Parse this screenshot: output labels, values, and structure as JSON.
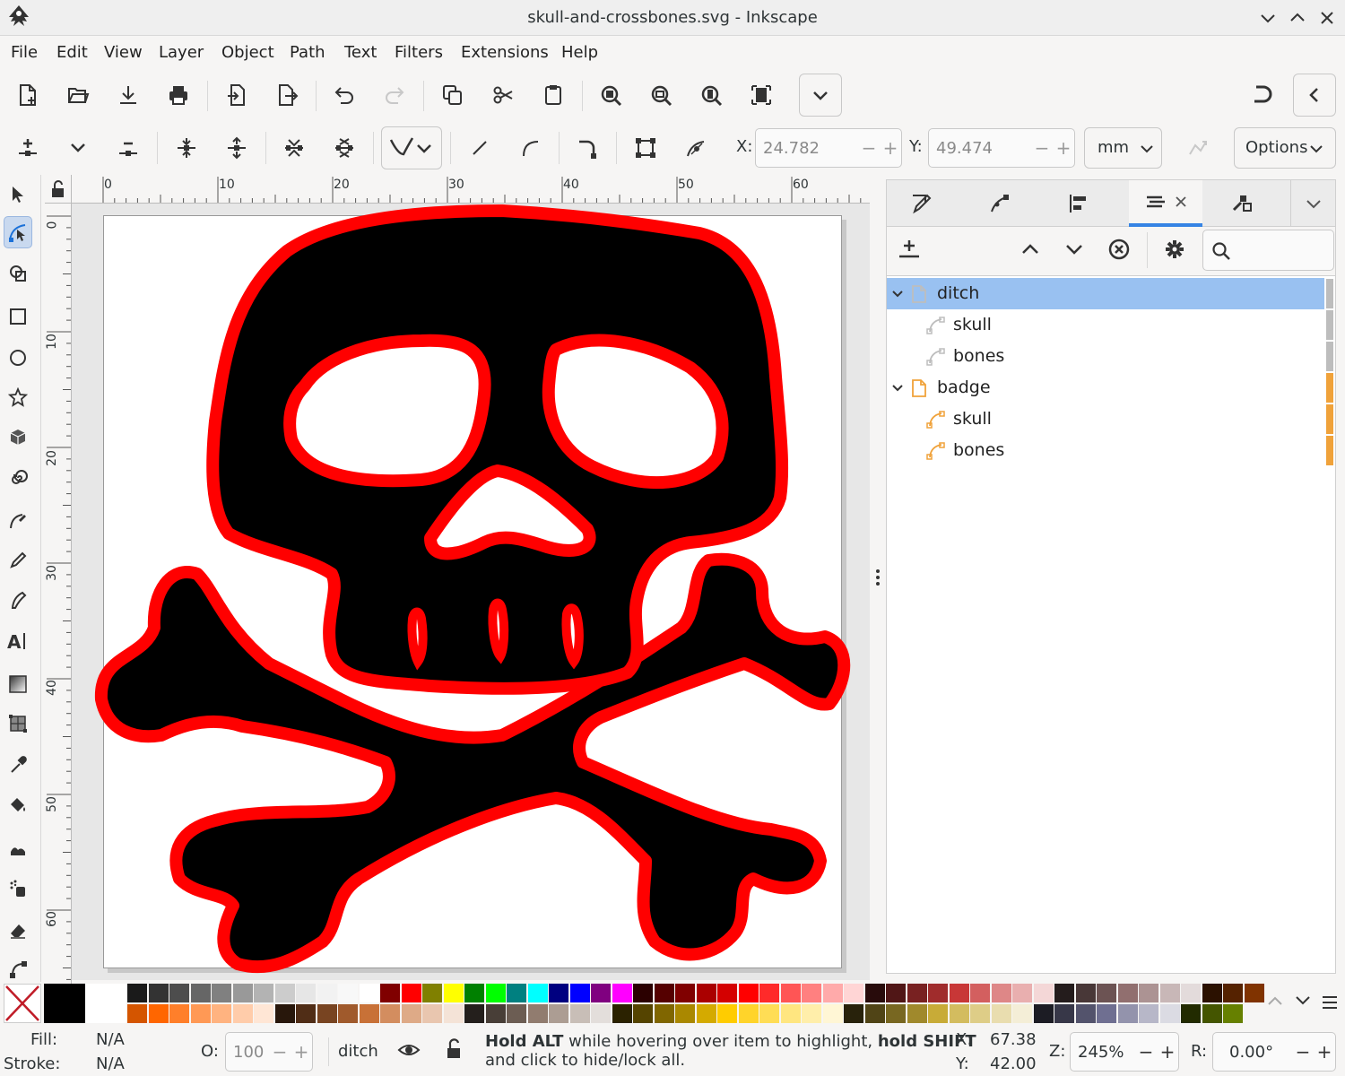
{
  "window": {
    "title": "skull-and-crossbones.svg - Inkscape"
  },
  "menu": [
    "File",
    "Edit",
    "View",
    "Layer",
    "Object",
    "Path",
    "Text",
    "Filters",
    "Extensions",
    "Help"
  ],
  "tool_controls": {
    "x_label": "X:",
    "x_value": "24.782",
    "y_label": "Y:",
    "y_value": "49.474",
    "units": "mm",
    "options_label": "Options"
  },
  "ruler_top": [
    "0",
    "10",
    "20",
    "30",
    "40",
    "50",
    "60"
  ],
  "ruler_left": [
    "0",
    "10",
    "20",
    "30",
    "40",
    "50",
    "60"
  ],
  "layers": {
    "rows": [
      {
        "label": "ditch",
        "level": 0,
        "kind": "layer",
        "selected": true,
        "tag": "#bdbdbd"
      },
      {
        "label": "skull",
        "level": 1,
        "kind": "path",
        "selected": false,
        "tag": "#bdbdbd"
      },
      {
        "label": "bones",
        "level": 1,
        "kind": "path",
        "selected": false,
        "tag": "#bdbdbd"
      },
      {
        "label": "badge",
        "level": 0,
        "kind": "layer",
        "selected": false,
        "tag": "#f0a23a"
      },
      {
        "label": "skull",
        "level": 1,
        "kind": "path",
        "selected": false,
        "tag": "#f0a23a"
      },
      {
        "label": "bones",
        "level": 1,
        "kind": "path",
        "selected": false,
        "tag": "#f0a23a"
      }
    ]
  },
  "status": {
    "fill_label": "Fill:",
    "fill_value": "N/A",
    "stroke_label": "Stroke:",
    "stroke_value": "N/A",
    "opacity_label": "O:",
    "opacity_value": "100",
    "layer_name": "ditch",
    "hint_bold1": "Hold ALT",
    "hint_text1": " while hovering over item to highlight, ",
    "hint_bold2": "hold SHIFT",
    "hint_text2": "and click to hide/lock all.",
    "cursor_x_label": "X:",
    "cursor_x": "67.38",
    "cursor_y_label": "Y:",
    "cursor_y": "42.00",
    "zoom_label": "Z:",
    "zoom": "245%",
    "rotate_label": "R:",
    "rotate": "0.00°"
  },
  "colors": {
    "accent": "#99c1f1",
    "stroke_red": "#ff0000",
    "fill_black": "#000000"
  },
  "palette_top": [
    "#1a1a1a",
    "#333333",
    "#4d4d4d",
    "#666666",
    "#808080",
    "#999999",
    "#b3b3b3",
    "#cccccc",
    "#e6e6e6",
    "#f2f2f2",
    "#f8f8f8",
    "#ffffff",
    "#800000",
    "#ff0000",
    "#808000",
    "#ffff00",
    "#008000",
    "#00ff00",
    "#008080",
    "#00ffff",
    "#000080",
    "#0000ff",
    "#800080",
    "#ff00ff",
    "#2b0000",
    "#550000",
    "#800000",
    "#aa0000",
    "#d40000",
    "#ff0000",
    "#ff2a2a",
    "#ff5555",
    "#ff8080",
    "#ffaaaa",
    "#ffd5d5",
    "#280b0b",
    "#501616",
    "#782121",
    "#a02c2c",
    "#c83737",
    "#d35f5f",
    "#de8787",
    "#e9afaf",
    "#f4d7d7",
    "#241c1c",
    "#483737",
    "#6c5353",
    "#916f6f",
    "#ac9393",
    "#c8b7b7",
    "#e3dbdb",
    "#2b1100",
    "#552200",
    "#803300"
  ],
  "palette_bottom": [
    "#d45500",
    "#ff6600",
    "#ff7f2a",
    "#ff9955",
    "#ffb380",
    "#ffccaa",
    "#ffe6d5",
    "#28170b",
    "#502d16",
    "#784421",
    "#a05a2c",
    "#c87137",
    "#d38d5f",
    "#deaa87",
    "#e9c6af",
    "#f4e3d7",
    "#241f1c",
    "#483e37",
    "#6c5d53",
    "#917c6f",
    "#ac9d93",
    "#c8beb7",
    "#e3dedb",
    "#2b2200",
    "#554400",
    "#806600",
    "#aa8800",
    "#d4aa00",
    "#ffcc00",
    "#ffd42a",
    "#ffdd55",
    "#ffe680",
    "#ffeeaa",
    "#fff6d5",
    "#28220b",
    "#504416",
    "#786721",
    "#a0892c",
    "#c8ab37",
    "#d3bc5f",
    "#decd87",
    "#e9ddaf",
    "#f4eed7",
    "#1c1c24",
    "#373748",
    "#53536c",
    "#6f6f91",
    "#9393ac",
    "#b7b7c8",
    "#dbdbe3",
    "#222b00",
    "#445500",
    "#668000"
  ]
}
